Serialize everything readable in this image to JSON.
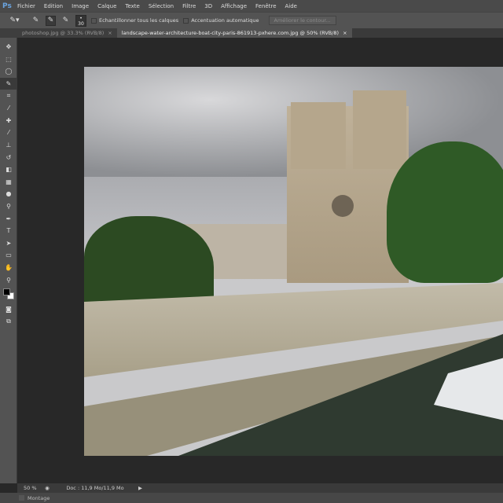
{
  "app": {
    "logo": "Ps"
  },
  "menu": [
    "Fichier",
    "Edition",
    "Image",
    "Calque",
    "Texte",
    "Sélection",
    "Filtre",
    "3D",
    "Affichage",
    "Fenêtre",
    "Aide"
  ],
  "options": {
    "brush_size": "30",
    "sample_all_layers": "Echantillonner tous les calques",
    "auto_enhance": "Accentuation automatique",
    "refine_edge": "Améliorer le contour..."
  },
  "tabs": [
    {
      "label": "photoshop.jpg @ 33.3% (RVB/8)",
      "close": "×"
    },
    {
      "label": "landscape-water-architecture-boat-city-paris-861913-pxhere.com.jpg @ 50% (RVB/8)",
      "close": "×"
    }
  ],
  "tools": [
    "move",
    "marquee",
    "lasso",
    "quick-selection",
    "crop",
    "eyedropper",
    "healing",
    "brush",
    "stamp",
    "history-brush",
    "eraser",
    "gradient",
    "blur",
    "dodge",
    "pen",
    "type",
    "path-selection",
    "rectangle",
    "hand",
    "zoom"
  ],
  "status": {
    "zoom": "50 %",
    "doc": "Doc : 11,9 Mo/11,9 Mo",
    "arrow": "▶"
  },
  "bottom": {
    "panel": "Montage"
  }
}
